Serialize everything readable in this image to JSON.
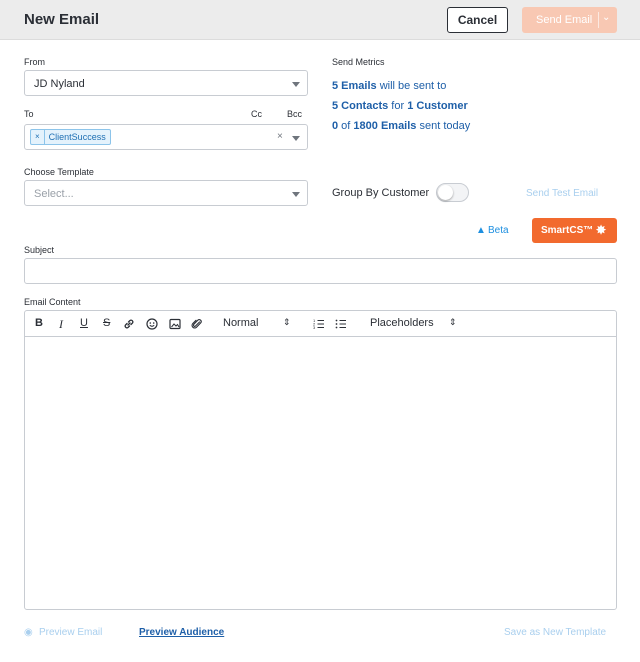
{
  "header": {
    "title": "New Email",
    "cancel_label": "Cancel",
    "send_label": "Send Email"
  },
  "form": {
    "from_label": "From",
    "from_value": "JD Nyland",
    "to_label": "To",
    "cc_label": "Cc",
    "bcc_label": "Bcc",
    "to_tags": [
      "ClientSuccess"
    ],
    "template_label": "Choose Template",
    "template_placeholder": "Select...",
    "subject_label": "Subject",
    "subject_value": "",
    "content_label": "Email Content"
  },
  "metrics": {
    "title": "Send Metrics",
    "emails_count": "5 Emails",
    "emails_suffix": " will be sent to",
    "contacts_count": "5 Contacts",
    "contacts_mid": " for ",
    "customer_count": "1 Customer",
    "sent_today_num": "0",
    "sent_today_mid": " of ",
    "sent_today_limit": "1800 Emails",
    "sent_today_suffix": " sent today"
  },
  "group_by": {
    "label": "Group By Customer",
    "on": false
  },
  "actions": {
    "send_test_label": "Send Test Email",
    "beta_label": "Beta",
    "smartcs_label": "SmartCS™"
  },
  "toolbar": {
    "bold": "B",
    "italic": "I",
    "underline": "U",
    "strike": "S",
    "format_value": "Normal",
    "placeholders_value": "Placeholders"
  },
  "footer": {
    "preview_email": "Preview Email",
    "preview_audience": "Preview Audience",
    "save_template": "Save as New Template"
  },
  "colors": {
    "accent_orange": "#f26a2e",
    "send_disabled": "#f8c8b3",
    "link_blue": "#1e5fa8",
    "disabled_blue": "#a9cfee"
  }
}
